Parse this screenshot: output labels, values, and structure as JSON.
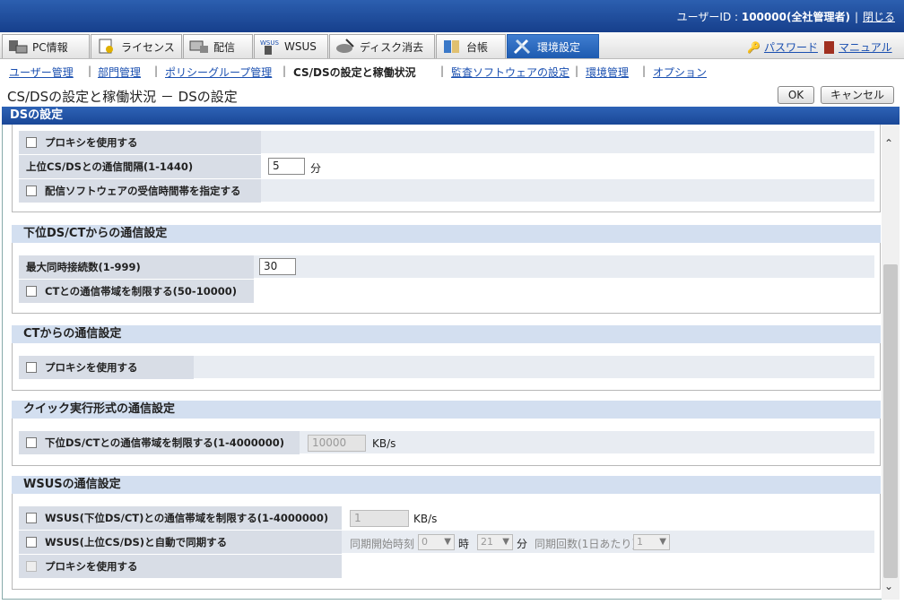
{
  "header": {
    "user_label": "ユーザーID : ",
    "user_value": "100000(全社管理者)",
    "separator": "|",
    "close_link": "閉じる"
  },
  "tabs": [
    {
      "label": "PC情報",
      "icon": "pc-icon"
    },
    {
      "label": "ライセンス",
      "icon": "license-icon"
    },
    {
      "label": "配信",
      "icon": "distribution-icon"
    },
    {
      "label": "WSUS",
      "icon": "wsus-icon"
    },
    {
      "label": "ディスク消去",
      "icon": "disk-erase-icon"
    },
    {
      "label": "台帳",
      "icon": "ledger-icon"
    },
    {
      "label": "環境設定",
      "icon": "settings-tools-icon"
    }
  ],
  "tab_icons_text": {
    "wsus": "WSUS"
  },
  "links": {
    "password": "パスワード",
    "manual": "マニュアル"
  },
  "subnav": {
    "user_mgmt": "ユーザー管理",
    "dept_mgmt": "部門管理",
    "policy_group": "ポリシーグループ管理",
    "csds": "CS/DSの設定と稼働状況",
    "audit": "監査ソフトウェアの設定",
    "env_mgmt": "環境管理",
    "option": "オプション",
    "sep": "|"
  },
  "page": {
    "title": "CS/DSの設定と稼働状況 － DSの設定",
    "ok": "OK",
    "cancel": "キャンセル",
    "section": "DSの設定"
  },
  "upper": {
    "proxy": "プロキシを使用する",
    "interval_label": "上位CS/DSとの通信間隔(1-1440)",
    "interval_value": "5",
    "interval_unit": "分",
    "recv_time": "配信ソフトウェアの受信時間帯を指定する"
  },
  "lower": {
    "title": "下位DS/CTからの通信設定",
    "max_conn_label": "最大同時接続数(1-999)",
    "max_conn_value": "30",
    "bandwidth": "CTとの通信帯域を制限する(50-10000)"
  },
  "ct": {
    "title": "CTからの通信設定",
    "proxy": "プロキシを使用する"
  },
  "quick": {
    "title": "クイック実行形式の通信設定",
    "limit": "下位DS/CTとの通信帯域を制限する(1-4000000)",
    "limit_value": "10000",
    "unit": "KB/s"
  },
  "wsus": {
    "title": "WSUSの通信設定",
    "limit": "WSUS(下位DS/CT)との通信帯域を制限する(1-4000000)",
    "limit_value": "1",
    "unit": "KB/s",
    "sync": "WSUS(上位CS/DS)と自動で同期する",
    "sync_start": "同期開始時刻",
    "hour_value": "0",
    "hour_unit": "時",
    "min_value": "21",
    "min_unit": "分",
    "sync_count": "同期回数(1日あたり)",
    "count_value": "1",
    "proxy": "プロキシを使用する"
  },
  "colors": {
    "accent": "#1e5bb0",
    "header": "#1a4797",
    "link": "#1a4fb0"
  }
}
